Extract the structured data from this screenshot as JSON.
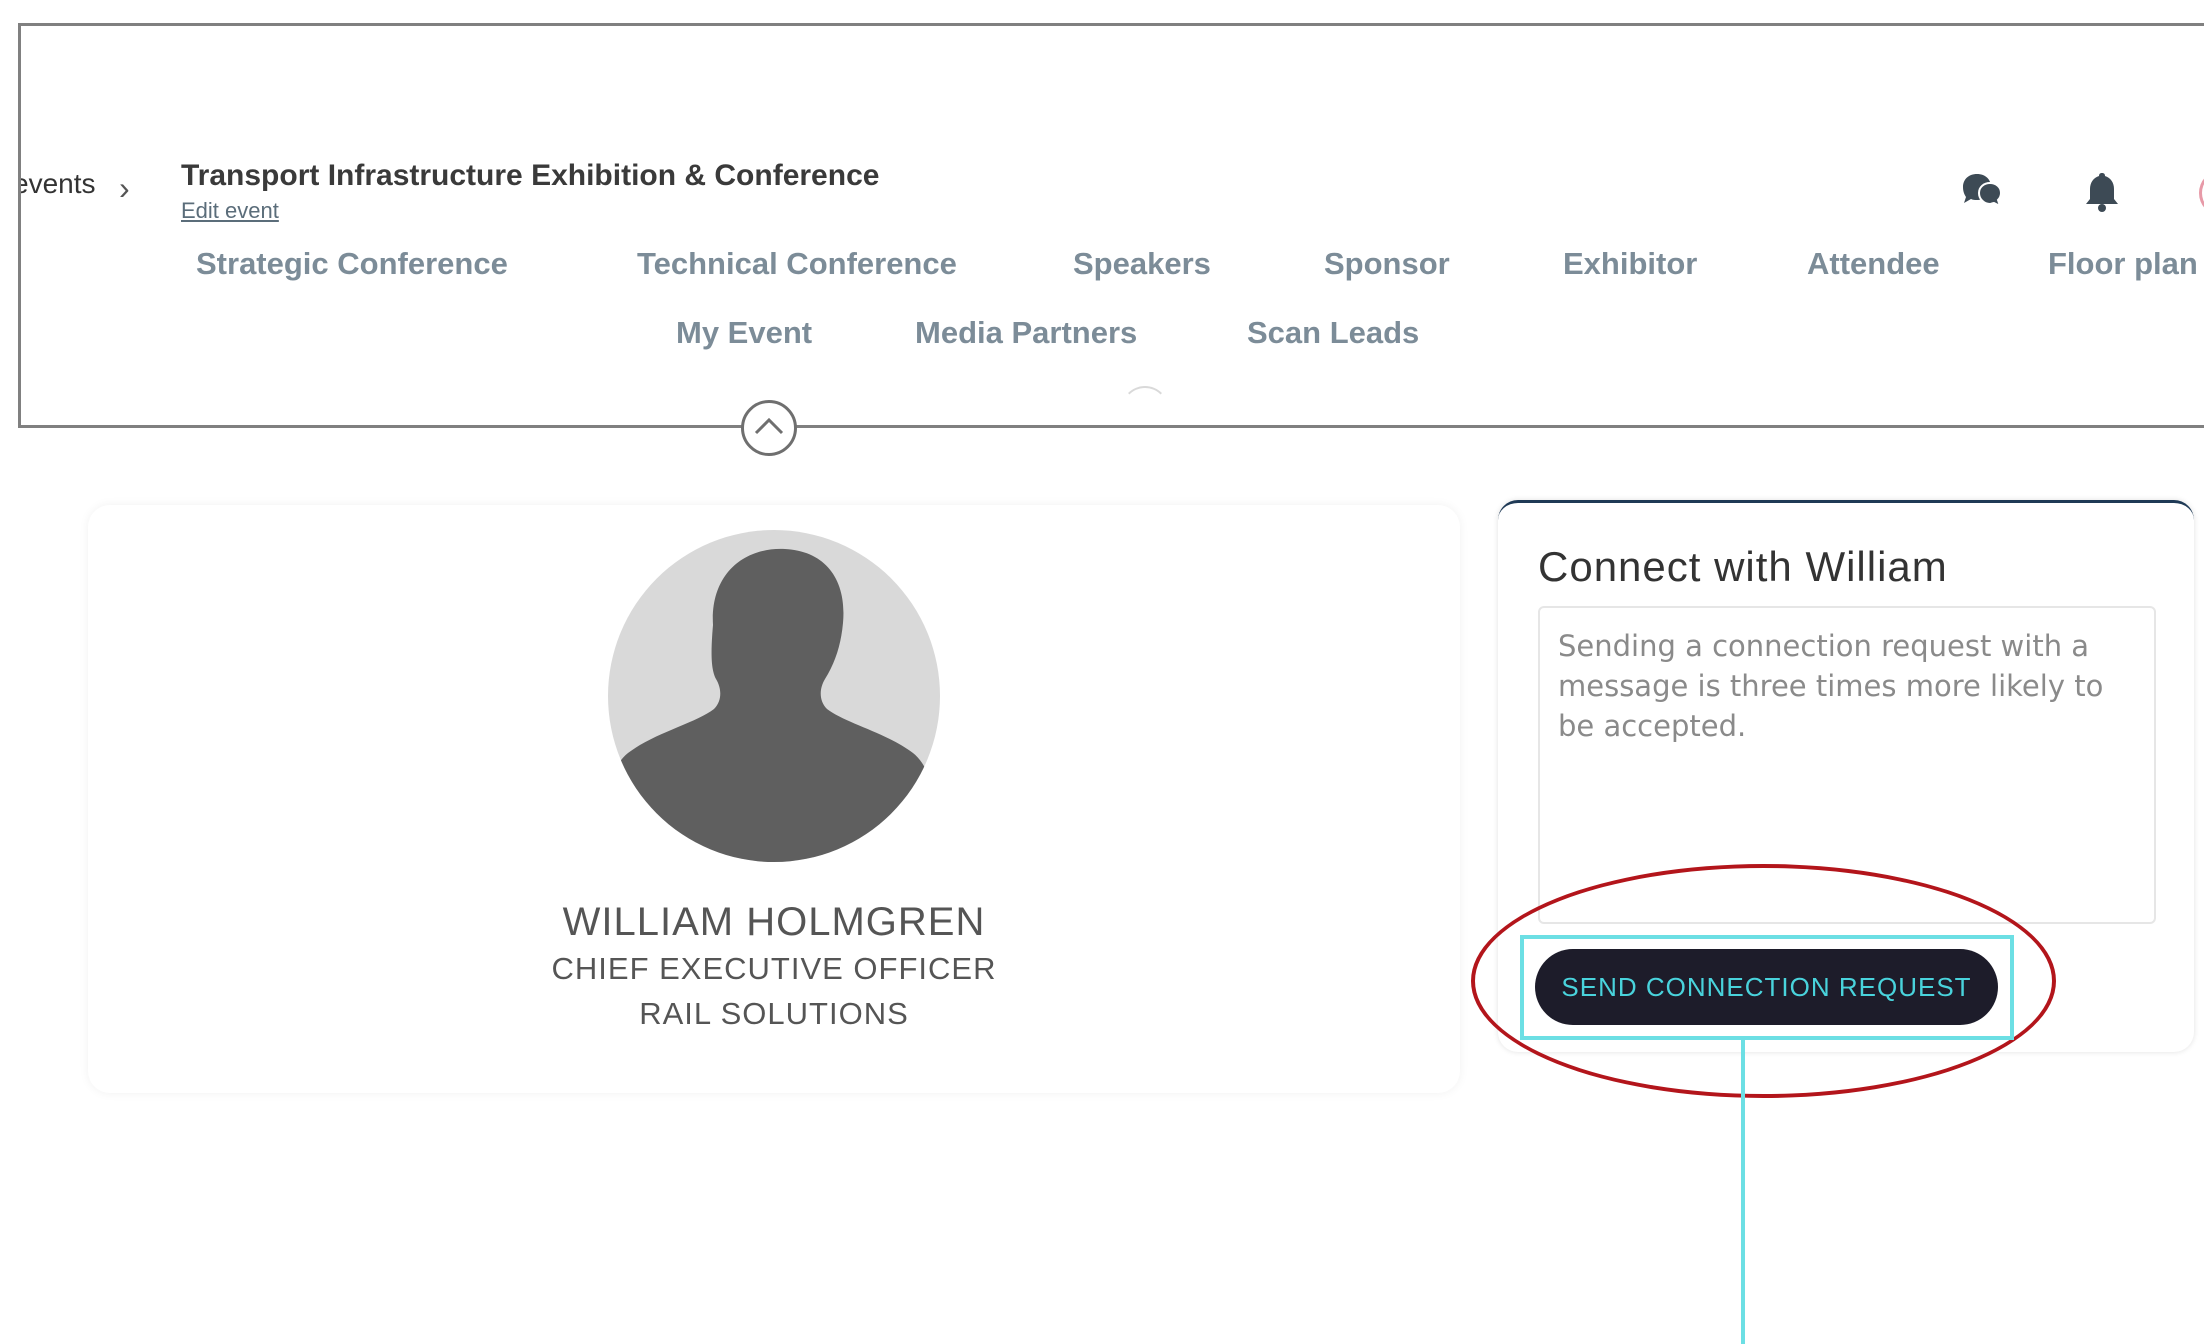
{
  "header": {
    "breadcrumb": "events",
    "event_title": "Transport Infrastructure Exhibition & Conference",
    "edit_link": "Edit event",
    "icons": [
      "chat-icon",
      "bell-icon"
    ]
  },
  "nav": {
    "row1": [
      "Strategic Conference",
      "Technical Conference",
      "Speakers",
      "Sponsor",
      "Exhibitor",
      "Attendee",
      "Floor plan"
    ],
    "row2": [
      "My Event",
      "Media Partners",
      "Scan Leads"
    ]
  },
  "profile": {
    "name": "WILLIAM HOLMGREN",
    "role": "CHIEF EXECUTIVE OFFICER",
    "company": "RAIL SOLUTIONS"
  },
  "connect": {
    "title": "Connect with William",
    "placeholder": "Sending a connection request with a message is three times more likely to be accepted.",
    "button_label": "SEND CONNECTION REQUEST"
  },
  "colors": {
    "nav_text": "#7c8c98",
    "button_bg": "#1d1c2a",
    "button_text": "#49d3dc",
    "annotation_red": "#b3151b",
    "annotation_cyan": "#6cdfe4"
  }
}
